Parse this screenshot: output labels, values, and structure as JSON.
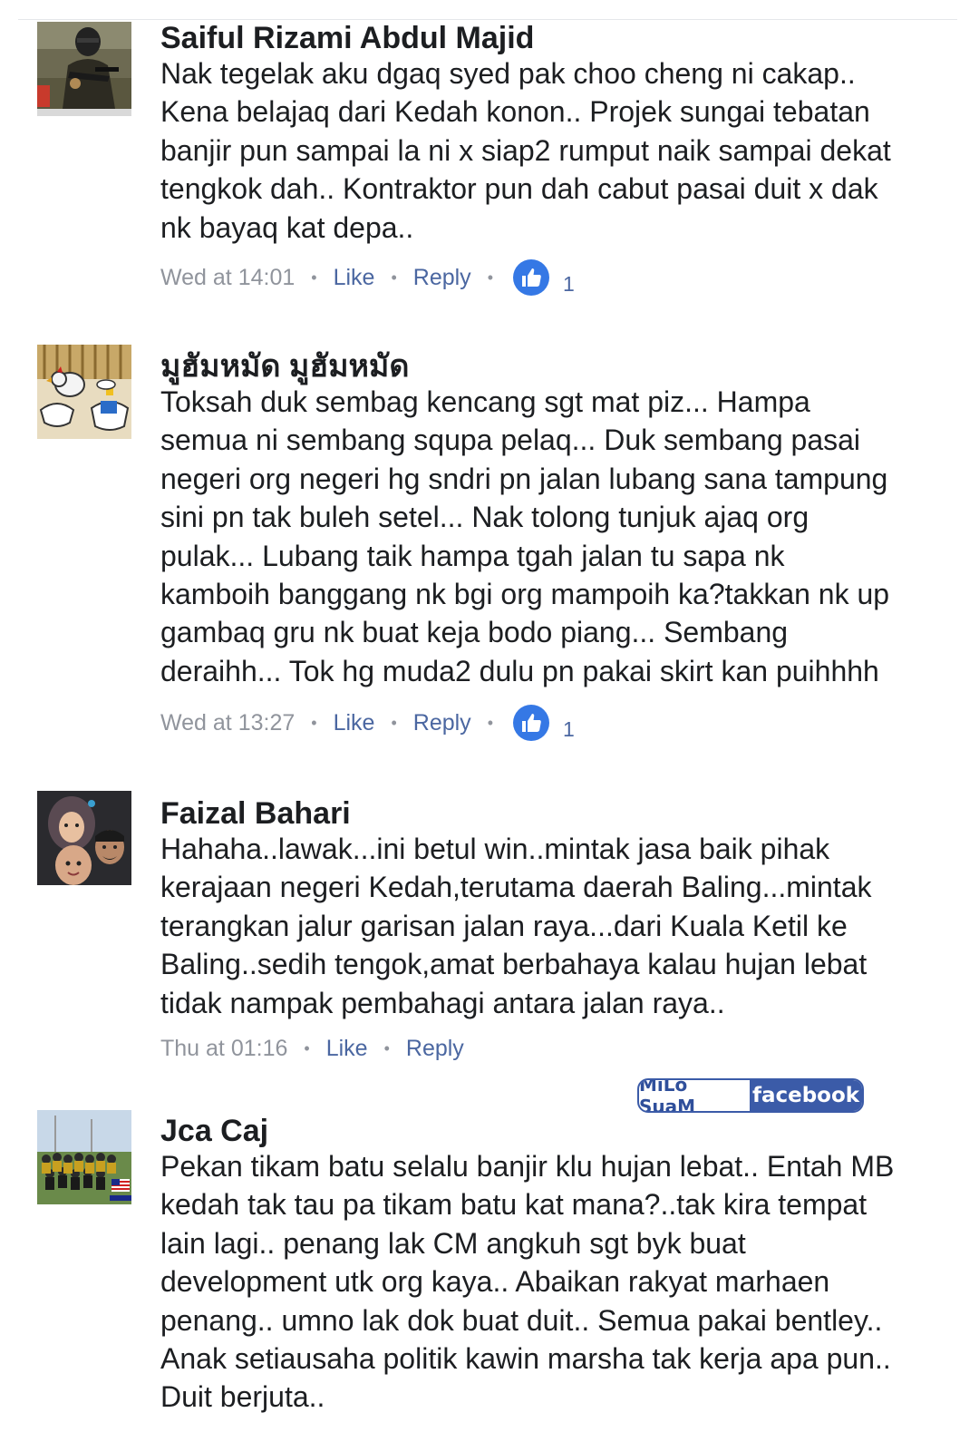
{
  "comments": [
    {
      "name": "Saiful Rizami Abdul Majid",
      "avatar_icon": "soldier-photo-icon",
      "lines": [
        "Nak tegelak aku dgaq syed pak choo cheng ni cakap..",
        "Kena belajaq dari Kedah konon.. Projek sungai tebatan",
        "banjir pun sampai la ni x siap2 rumput naik sampai dekat",
        "tengkok dah.. Kontraktor pun dah cabut pasai duit x dak",
        "nk bayaq kat depa.."
      ],
      "time": "Wed at 14:01",
      "like_label": "Like",
      "reply_label": "Reply",
      "reaction_count": "1"
    },
    {
      "name": "มูฮัมหมัด มูฮัมหมัด",
      "avatar_icon": "cartoon-chicken-icon",
      "lines": [
        "Toksah duk sembag kencang sgt mat piz... Hampa",
        "semua ni sembang squpa pelaq... Duk sembang pasai",
        "negeri org negeri hg sndri pn jalan lubang sana tampung",
        "sini pn tak buleh setel... Nak tolong tunjuk ajaq org",
        "pulak... Lubang taik hampa tgah jalan tu sapa nk",
        "kamboih banggang nk bgi org mampoih ka?takkan nk up",
        "gambaq gru nk buat keja bodo piang... Sembang",
        "deraihh... Tok hg muda2 dulu pn pakai skirt kan puihhhh"
      ],
      "time": "Wed at 13:27",
      "like_label": "Like",
      "reply_label": "Reply",
      "reaction_count": "1"
    },
    {
      "name": "Faizal Bahari",
      "avatar_icon": "family-photo-icon",
      "lines": [
        "Hahaha..lawak...ini betul win..mintak jasa baik pihak",
        "kerajaan negeri Kedah,terutama daerah Baling...mintak",
        "terangkan jalur garisan jalan raya...dari Kuala Ketil ke",
        "Baling..sedih tengok,amat berbahaya kalau hujan lebat",
        "tidak nampak pembahagi antara jalan raya.."
      ],
      "time": "Thu at 01:16",
      "like_label": "Like",
      "reply_label": "Reply"
    },
    {
      "name": "Jca Caj",
      "avatar_icon": "group-photo-icon",
      "lines": [
        "Pekan tikam batu selalu banjir klu hujan lebat.. Entah MB",
        "kedah tak tau pa tikam batu kat mana?..tak kira tempat",
        "lain lagi.. penang lak CM angkuh sgt byk buat",
        "development utk org kaya.. Abaikan rakyat marhaen",
        "penang.. umno lak dok buat duit.. Semua pakai bentley..",
        "Anak setiausaha politik kawin marsha tak kerja apa pun..",
        "Duit berjuta.."
      ]
    }
  ],
  "watermark": {
    "left_text": "MiLo SuaM",
    "right_text": "facebook"
  },
  "colors": {
    "link": "#4b67a1",
    "meta_gray": "#90949c",
    "like_badge": "#3578e5"
  }
}
